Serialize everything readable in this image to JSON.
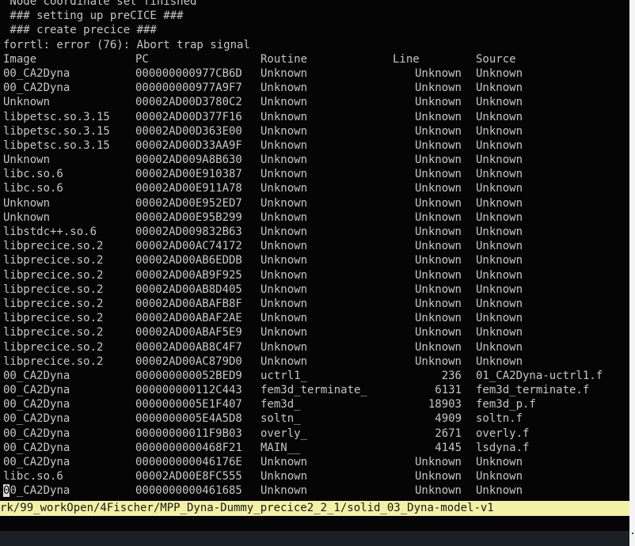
{
  "messages": [
    " Node coordinate set finished",
    " ### setting up preCICE ###",
    " ### create precice ###",
    "forrtl: error (76): Abort trap signal"
  ],
  "header": {
    "image": "Image",
    "pc": "PC",
    "routine": "Routine",
    "line": "Line",
    "source": "Source"
  },
  "trace_rows": [
    {
      "image": "00_CA2Dyna",
      "pc": "000000000977CB6D",
      "routine": "Unknown",
      "line": "Unknown",
      "source": "Unknown"
    },
    {
      "image": "00_CA2Dyna",
      "pc": "000000000977A9F7",
      "routine": "Unknown",
      "line": "Unknown",
      "source": "Unknown"
    },
    {
      "image": "Unknown",
      "pc": "00002AD00D3780C2",
      "routine": "Unknown",
      "line": "Unknown",
      "source": "Unknown"
    },
    {
      "image": "libpetsc.so.3.15",
      "pc": "00002AD00D377F16",
      "routine": "Unknown",
      "line": "Unknown",
      "source": "Unknown"
    },
    {
      "image": "libpetsc.so.3.15",
      "pc": "00002AD00D363E00",
      "routine": "Unknown",
      "line": "Unknown",
      "source": "Unknown"
    },
    {
      "image": "libpetsc.so.3.15",
      "pc": "00002AD00D33AA9F",
      "routine": "Unknown",
      "line": "Unknown",
      "source": "Unknown"
    },
    {
      "image": "Unknown",
      "pc": "00002AD009A8B630",
      "routine": "Unknown",
      "line": "Unknown",
      "source": "Unknown"
    },
    {
      "image": "libc.so.6",
      "pc": "00002AD00E910387",
      "routine": "Unknown",
      "line": "Unknown",
      "source": "Unknown"
    },
    {
      "image": "libc.so.6",
      "pc": "00002AD00E911A78",
      "routine": "Unknown",
      "line": "Unknown",
      "source": "Unknown"
    },
    {
      "image": "Unknown",
      "pc": "00002AD00E952ED7",
      "routine": "Unknown",
      "line": "Unknown",
      "source": "Unknown"
    },
    {
      "image": "Unknown",
      "pc": "00002AD00E95B299",
      "routine": "Unknown",
      "line": "Unknown",
      "source": "Unknown"
    },
    {
      "image": "libstdc++.so.6",
      "pc": "00002AD009832B63",
      "routine": "Unknown",
      "line": "Unknown",
      "source": "Unknown"
    },
    {
      "image": "libprecice.so.2",
      "pc": "00002AD00AC74172",
      "routine": "Unknown",
      "line": "Unknown",
      "source": "Unknown"
    },
    {
      "image": "libprecice.so.2",
      "pc": "00002AD00AB6EDDB",
      "routine": "Unknown",
      "line": "Unknown",
      "source": "Unknown"
    },
    {
      "image": "libprecice.so.2",
      "pc": "00002AD00AB9F925",
      "routine": "Unknown",
      "line": "Unknown",
      "source": "Unknown"
    },
    {
      "image": "libprecice.so.2",
      "pc": "00002AD00AB8D405",
      "routine": "Unknown",
      "line": "Unknown",
      "source": "Unknown"
    },
    {
      "image": "libprecice.so.2",
      "pc": "00002AD00ABAFB8F",
      "routine": "Unknown",
      "line": "Unknown",
      "source": "Unknown"
    },
    {
      "image": "libprecice.so.2",
      "pc": "00002AD00ABAF2AE",
      "routine": "Unknown",
      "line": "Unknown",
      "source": "Unknown"
    },
    {
      "image": "libprecice.so.2",
      "pc": "00002AD00ABAF5E9",
      "routine": "Unknown",
      "line": "Unknown",
      "source": "Unknown"
    },
    {
      "image": "libprecice.so.2",
      "pc": "00002AD00AB8C4F7",
      "routine": "Unknown",
      "line": "Unknown",
      "source": "Unknown"
    },
    {
      "image": "libprecice.so.2",
      "pc": "00002AD00AC879D0",
      "routine": "Unknown",
      "line": "Unknown",
      "source": "Unknown"
    },
    {
      "image": "00_CA2Dyna",
      "pc": "000000000052BED9",
      "routine": "uctrl1_",
      "line": "236",
      "source": "01_CA2Dyna-uctrl1.f"
    },
    {
      "image": "00_CA2Dyna",
      "pc": "000000000112C443",
      "routine": "fem3d_terminate_",
      "line": "6131",
      "source": "fem3d_terminate.f"
    },
    {
      "image": "00_CA2Dyna",
      "pc": "0000000005E1F407",
      "routine": "fem3d_",
      "line": "18903",
      "source": "fem3d_p.f"
    },
    {
      "image": "00_CA2Dyna",
      "pc": "0000000005E4A5D8",
      "routine": "soltn_",
      "line": "4909",
      "source": "soltn.f"
    },
    {
      "image": "00_CA2Dyna",
      "pc": "00000000011F9B03",
      "routine": "overly_",
      "line": "2671",
      "source": "overly.f"
    },
    {
      "image": "00_CA2Dyna",
      "pc": "0000000000468F21",
      "routine": "MAIN__",
      "line": "4145",
      "source": "lsdyna.f"
    },
    {
      "image": "00_CA2Dyna",
      "pc": "000000000046176E",
      "routine": "Unknown",
      "line": "Unknown",
      "source": "Unknown"
    },
    {
      "image": "libc.so.6",
      "pc": "00002AD00E8FC555",
      "routine": "Unknown",
      "line": "Unknown",
      "source": "Unknown"
    }
  ],
  "last_row": {
    "cursor_char": "0",
    "image_rest": "0_CA2Dyna",
    "pc": "0000000000461685",
    "routine": "Unknown",
    "line": "Unknown",
    "source": "Unknown"
  },
  "status_bar": {
    "path": "rk/99_workOpen/4Fischer/MPP_Dyna-Dummy_precice2_2_1/solid_03_Dyna-model-v1"
  },
  "colors": {
    "background": "#050505",
    "foreground": "#c6c6c6",
    "status_bar_bg": "#f4f1a6",
    "status_bar_fg": "#1a1a1a",
    "bottom_band": "#1b1f26"
  }
}
